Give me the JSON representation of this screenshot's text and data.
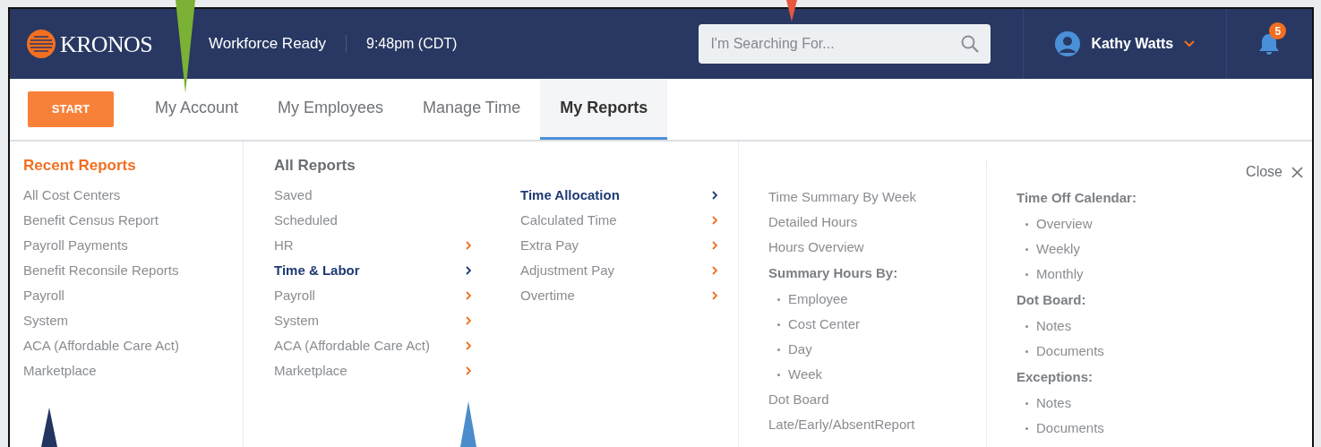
{
  "header": {
    "logo": "KRONOS",
    "product": "Workforce Ready",
    "time": "9:48pm (CDT)",
    "search": {
      "placeholder": "I'm Searching For..."
    },
    "user": "Kathy Watts",
    "notifications": "5"
  },
  "start_button": "START",
  "tabs": [
    {
      "label": "My Account",
      "selected": false
    },
    {
      "label": "My Employees",
      "selected": false
    },
    {
      "label": "Manage Time",
      "selected": false
    },
    {
      "label": "My Reports",
      "selected": true
    }
  ],
  "recent_reports": {
    "title": "Recent Reports",
    "items": [
      "All Cost Centers",
      "Benefit Census Report",
      "Payroll Payments",
      "Benefit Reconsile Reports",
      "Payroll",
      "System",
      "ACA (Affordable Care Act)",
      "Marketplace"
    ]
  },
  "all_reports": {
    "title": "All Reports",
    "items": [
      {
        "label": "Saved",
        "has_submenu": false,
        "selected": false
      },
      {
        "label": "Scheduled",
        "has_submenu": false,
        "selected": false
      },
      {
        "label": "HR",
        "has_submenu": true,
        "selected": false
      },
      {
        "label": "Time & Labor",
        "has_submenu": true,
        "selected": true
      },
      {
        "label": "Payroll",
        "has_submenu": true,
        "selected": false
      },
      {
        "label": "System",
        "has_submenu": true,
        "selected": false
      },
      {
        "label": "ACA (Affordable Care Act)",
        "has_submenu": true,
        "selected": false
      },
      {
        "label": "Marketplace",
        "has_submenu": true,
        "selected": false
      }
    ]
  },
  "time_labor": {
    "items": [
      {
        "label": "Time Allocation",
        "has_submenu": true,
        "selected": true
      },
      {
        "label": "Calculated Time",
        "has_submenu": true,
        "selected": false
      },
      {
        "label": "Extra Pay",
        "has_submenu": true,
        "selected": false
      },
      {
        "label": "Adjustment Pay",
        "has_submenu": true,
        "selected": false
      },
      {
        "label": "Overtime",
        "has_submenu": true,
        "selected": false
      }
    ]
  },
  "time_allocation": {
    "items": [
      {
        "kind": "link",
        "label": "Time Summary By Week"
      },
      {
        "kind": "link",
        "label": "Detailed Hours"
      },
      {
        "kind": "link",
        "label": "Hours Overview"
      },
      {
        "kind": "heading",
        "label": "Summary Hours By:"
      },
      {
        "kind": "bullet",
        "label": "Employee"
      },
      {
        "kind": "bullet",
        "label": "Cost Center"
      },
      {
        "kind": "bullet",
        "label": "Day"
      },
      {
        "kind": "bullet",
        "label": "Week"
      },
      {
        "kind": "link",
        "label": "Dot Board"
      },
      {
        "kind": "link",
        "label": "Late/Early/AbsentReport"
      }
    ]
  },
  "more": {
    "close": "Close",
    "items": [
      {
        "kind": "heading",
        "label": "Time Off Calendar:"
      },
      {
        "kind": "bullet",
        "label": "Overview"
      },
      {
        "kind": "bullet",
        "label": "Weekly"
      },
      {
        "kind": "bullet",
        "label": "Monthly"
      },
      {
        "kind": "heading",
        "label": "Dot Board:"
      },
      {
        "kind": "bullet",
        "label": "Notes"
      },
      {
        "kind": "bullet",
        "label": "Documents"
      },
      {
        "kind": "heading",
        "label": "Exceptions:"
      },
      {
        "kind": "bullet",
        "label": "Notes"
      },
      {
        "kind": "bullet",
        "label": "Documents"
      }
    ]
  }
}
